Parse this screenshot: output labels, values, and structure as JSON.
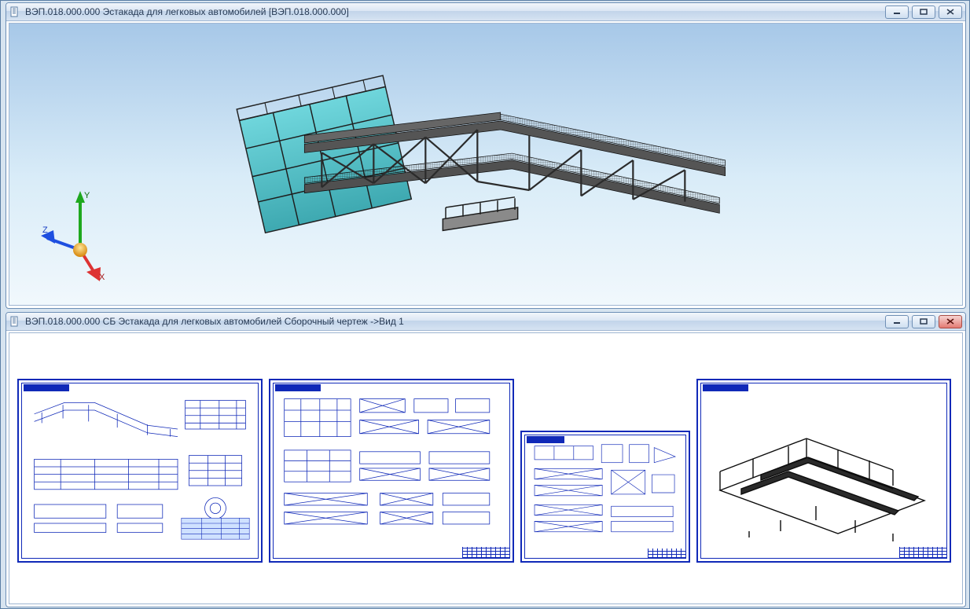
{
  "windows": {
    "top": {
      "title": "ВЭП.018.000.000 Эстакада для легковых автомобилей [ВЭП.018.000.000]",
      "axes": {
        "x": "X",
        "y": "Y",
        "z": "Z"
      }
    },
    "bottom": {
      "title": "ВЭП.018.000.000 СБ Эстакада для легковых автомобилей Сборочный чертеж ->Вид 1"
    }
  },
  "icons": {
    "doc": "doc-icon",
    "min": "minimize",
    "max": "maximize",
    "close": "close"
  },
  "colors": {
    "frame": "#1029b8",
    "ramp_fill": "#5ac7cf",
    "steel": "#3a3a3a"
  }
}
